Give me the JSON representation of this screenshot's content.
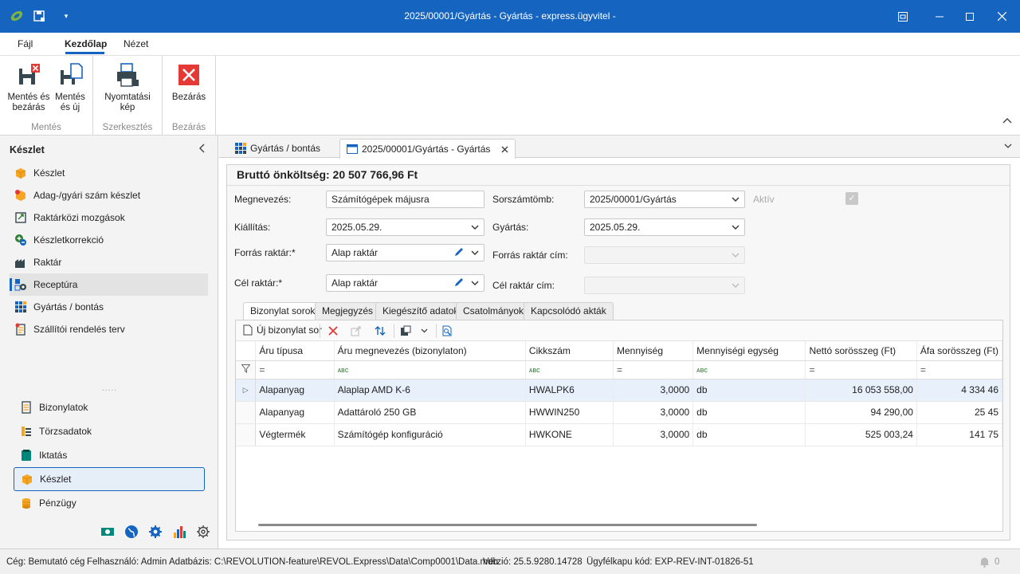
{
  "window": {
    "title": "2025/00001/Gyártás - Gyártás - express.ügyvitel -"
  },
  "menu": {
    "tabs": [
      "Fájl",
      "Kezdőlap",
      "Nézet"
    ],
    "active": "Kezdőlap"
  },
  "ribbon": {
    "groups": [
      {
        "label": "Mentés",
        "buttons": [
          "Mentés és\nbezárás",
          "Mentés\nés új"
        ]
      },
      {
        "label": "Szerkesztés",
        "buttons": [
          "Nyomtatási\nkép"
        ]
      },
      {
        "label": "Bezárás",
        "buttons": [
          "Bezárás"
        ]
      }
    ],
    "save_close_l1": "Mentés és",
    "save_close_l2": "bezárás",
    "save_new_l1": "Mentés",
    "save_new_l2": "és új",
    "print_l1": "Nyomtatási",
    "print_l2": "kép",
    "close": "Bezárás",
    "group_save": "Mentés",
    "group_edit": "Szerkesztés",
    "group_close": "Bezárás"
  },
  "sidebar": {
    "title": "Készlet",
    "items": [
      {
        "label": "Készlet",
        "icon": "box-icon"
      },
      {
        "label": "Adag-/gyári szám készlet",
        "icon": "batch-icon"
      },
      {
        "label": "Raktárközi mozgások",
        "icon": "transfer-icon"
      },
      {
        "label": "Készletkorrekció",
        "icon": "correction-icon"
      },
      {
        "label": "Raktár",
        "icon": "warehouse-icon"
      },
      {
        "label": "Receptúra",
        "icon": "recipe-icon"
      },
      {
        "label": "Gyártás / bontás",
        "icon": "production-icon"
      },
      {
        "label": "Szállítói rendelés terv",
        "icon": "order-plan-icon"
      }
    ],
    "selected": "Receptúra",
    "modules": [
      {
        "label": "Bizonylatok",
        "icon": "documents-icon"
      },
      {
        "label": "Törzsadatok",
        "icon": "master-data-icon"
      },
      {
        "label": "Iktatás",
        "icon": "filing-icon"
      },
      {
        "label": "Készlet",
        "icon": "box-icon"
      },
      {
        "label": "Pénzügy",
        "icon": "coins-icon"
      }
    ],
    "selected_module": "Készlet"
  },
  "doc_tabs": [
    {
      "label": "Gyártás / bontás"
    },
    {
      "label": "2025/00001/Gyártás - Gyártás"
    }
  ],
  "form": {
    "total": "Bruttó önköltség: 20 507 766,96 Ft",
    "name_label": "Megnevezés:",
    "name_value": "Számítógépek májusra",
    "series_label": "Sorszámtömb:",
    "series_value": "2025/00001/Gyártás",
    "active_label": "Aktív",
    "issue_label": "Kiállítás:",
    "issue_value": "2025.05.29.",
    "prod_label": "Gyártás:",
    "prod_value": "2025.05.29.",
    "src_wh_label": "Forrás raktár:*",
    "src_wh_value": "Alap raktár",
    "src_addr_label": "Forrás raktár cím:",
    "dst_wh_label": "Cél raktár:*",
    "dst_wh_value": "Alap raktár",
    "dst_addr_label": "Cél raktár cím:"
  },
  "subtabs": [
    "Bizonylat sorok",
    "Megjegyzés",
    "Kiegészítő adatok",
    "Csatolmányok",
    "Kapcsolódó akták"
  ],
  "grid": {
    "new_row_label": "Új bizonylat sor",
    "columns": [
      "Áru típusa",
      "Áru megnevezés (bizonylaton)",
      "Cikkszám",
      "Mennyiség",
      "Mennyiségi egység",
      "Nettó sorösszeg (Ft)",
      "Áfa sorösszeg (Ft)"
    ],
    "filter": [
      "=",
      "ᴀʙᴄ",
      "ᴀʙᴄ",
      "=",
      "ᴀʙᴄ",
      "=",
      "="
    ],
    "rows": [
      [
        "Alapanyag",
        "Alaplap AMD K-6",
        "HWALPK6",
        "3,0000",
        "db",
        "16 053 558,00",
        "4 334 46"
      ],
      [
        "Alapanyag",
        "Adattároló 250 GB",
        "HWWIN250",
        "3,0000",
        "db",
        "94 290,00",
        "25 45"
      ],
      [
        "Végtermék",
        "Számítógép konfiguráció",
        "HWKONE",
        "3,0000",
        "db",
        "525 003,24",
        "141 75"
      ]
    ]
  },
  "status": {
    "company": "Cég: Bemutató cég",
    "user": "Felhasználó: Admin",
    "db": "Adatbázis: C:\\REVOLUTION-feature\\REVOL.Express\\Data\\Comp0001\\Data.mdb",
    "version": "Verzió: 25.5.9280.14728",
    "portal": "Ügyfélkapu kód: EXP-REV-INT-01826-51",
    "notifications": "0"
  },
  "colors": {
    "accent": "#1565c0",
    "close_red": "#e53935"
  }
}
